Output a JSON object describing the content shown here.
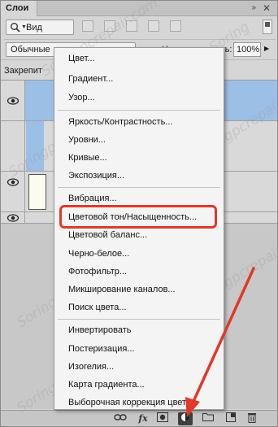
{
  "panel": {
    "title": "Слои",
    "filter_label": "Вид",
    "blend_mode": "Обычные",
    "opacity_label": "Непрозрачность:",
    "opacity_value": "100%",
    "lock_label": "Закрепит"
  },
  "layers": [
    {
      "visible": true,
      "selected": true,
      "has_thumb": false
    },
    {
      "visible": false,
      "selected": false,
      "has_thumb": false
    },
    {
      "visible": true,
      "selected": false,
      "has_thumb": true
    },
    {
      "visible": true,
      "selected": false,
      "has_thumb": true
    }
  ],
  "menu": {
    "items": [
      "Цвет...",
      "Градиент...",
      "Узор...",
      "Яркость/Контрастность...",
      "Уровни...",
      "Кривые...",
      "Экспозиция...",
      "Вибрация...",
      "Цветовой тон/Насыщенность...",
      "Цветовой баланс...",
      "Черно-белое...",
      "Фотофильтр...",
      "Микширование каналов...",
      "Поиск цвета...",
      "Инвертировать",
      "Постеризация...",
      "Изогелия...",
      "Карта градиента...",
      "Выборочная коррекция цвета..."
    ],
    "highlighted_item": "Цветовой тон/Насыщенность..."
  },
  "toolbar": {
    "fx_label": "fx"
  },
  "watermark": "Soringpcrepair.com",
  "colors": {
    "highlight": "#e0392b",
    "selected_layer": "#9cbfe6",
    "arrow": "#e0392b"
  }
}
